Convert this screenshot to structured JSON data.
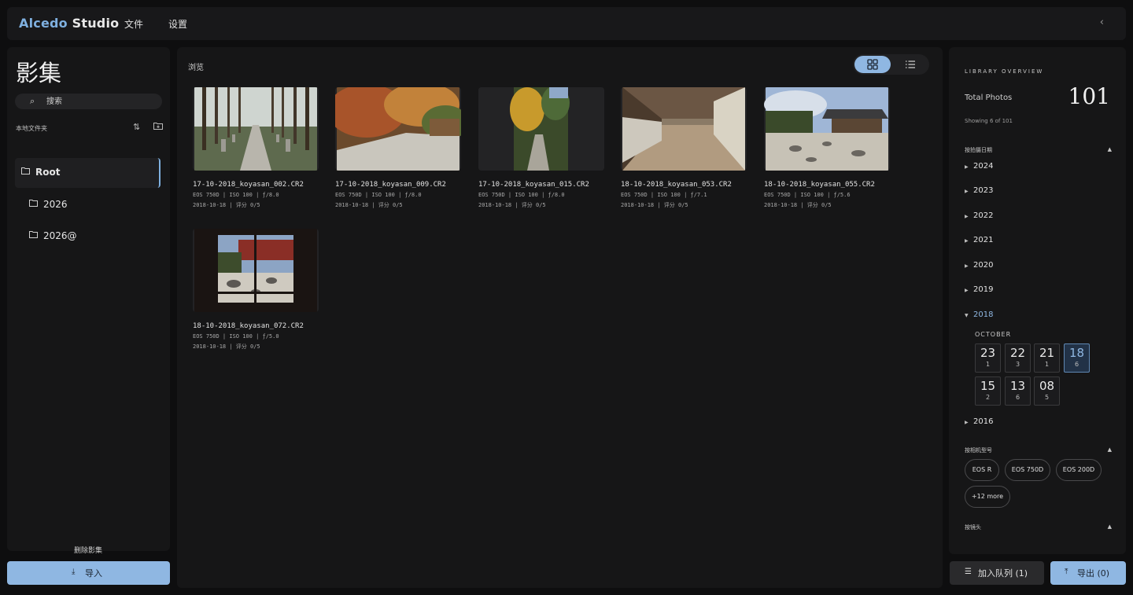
{
  "app": {
    "brand_a": "Alcedo",
    "brand_b": " Studio"
  },
  "menu": {
    "file": "文件",
    "settings": "设置",
    "collapse_icon": "‹"
  },
  "left": {
    "title": "影集",
    "search_placeholder": "搜索",
    "local_folders_label": "本地文件夹",
    "folders": [
      {
        "label": "Root",
        "active": true
      },
      {
        "label": "2026",
        "active": false
      },
      {
        "label": "2026@",
        "active": false
      }
    ],
    "delete_label": "删除影集",
    "import_label": "导入"
  },
  "main": {
    "browse_label": "浏览",
    "photos": [
      {
        "name": "17-10-2018_koyasan_002.CR2",
        "meta1": "EOS 750D | ISO 100 | ƒ/8.0",
        "meta2": "2018-10-18 | 评分 0/5"
      },
      {
        "name": "17-10-2018_koyasan_009.CR2",
        "meta1": "EOS 750D | ISO 100 | ƒ/8.0",
        "meta2": "2018-10-18 | 评分 0/5"
      },
      {
        "name": "17-10-2018_koyasan_015.CR2",
        "meta1": "EOS 750D | ISO 100 | ƒ/8.0",
        "meta2": "2018-10-18 | 评分 0/5"
      },
      {
        "name": "18-10-2018_koyasan_053.CR2",
        "meta1": "EOS 750D | ISO 100 | ƒ/7.1",
        "meta2": "2018-10-18 | 评分 0/5"
      },
      {
        "name": "18-10-2018_koyasan_055.CR2",
        "meta1": "EOS 750D | ISO 100 | ƒ/5.6",
        "meta2": "2018-10-18 | 评分 0/5"
      },
      {
        "name": "18-10-2018_koyasan_072.CR2",
        "meta1": "EOS 750D | ISO 100 | ƒ/5.0",
        "meta2": "2018-10-18 | 评分 0/5"
      }
    ]
  },
  "right": {
    "overview_title": "LIBRARY OVERVIEW",
    "total_label": "Total Photos",
    "total_value": "101",
    "showing": "Showing 6 of 101",
    "by_date_label": "按拍摄日期",
    "years": [
      "2024",
      "2023",
      "2022",
      "2021",
      "2020",
      "2019",
      "2018",
      "2016"
    ],
    "open_year": "2018",
    "month": "OCTOBER",
    "days": [
      {
        "day": "23",
        "count": "1"
      },
      {
        "day": "22",
        "count": "3"
      },
      {
        "day": "21",
        "count": "1"
      },
      {
        "day": "18",
        "count": "6"
      },
      {
        "day": "15",
        "count": "2"
      },
      {
        "day": "13",
        "count": "6"
      },
      {
        "day": "08",
        "count": "5"
      }
    ],
    "by_camera_label": "按相机型号",
    "cameras": [
      "EOS R",
      "EOS 750D",
      "EOS 200D",
      "+12 more"
    ],
    "by_lens_label": "按镜头",
    "toggle_icon": "▲"
  },
  "footer": {
    "queue_label": "加入队列 (1)",
    "export_label": "导出 (0)"
  },
  "colors": {
    "accent": "#8fb7e2",
    "panel": "#161617",
    "background": "#0e0e0f"
  }
}
